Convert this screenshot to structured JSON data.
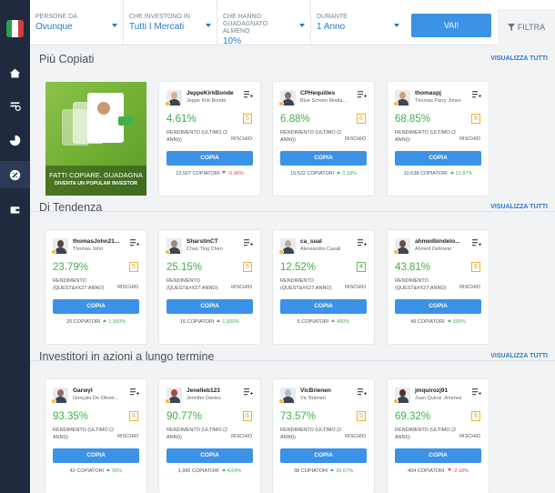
{
  "filters": [
    {
      "label": "PERSONE DA",
      "value": "Ovunque"
    },
    {
      "label": "CHE INVESTONO IN",
      "value": "Tutti I Mercati"
    },
    {
      "label": "CHE HANNO GUADAGNATO ALMENO",
      "value": "10%"
    },
    {
      "label": "DURANTE",
      "value": "1 Anno"
    }
  ],
  "go_button": "VAI!",
  "filter_button": "FILTRA",
  "sections": [
    {
      "title": "Più Copiati",
      "link": "VISUALIZZA TUTTI"
    },
    {
      "title": "Di Tendenza",
      "link": "VISUALIZZA TUTTI"
    },
    {
      "title": "Investitori in azioni a lungo termine",
      "link": "VISUALIZZA TUTTI"
    }
  ],
  "promo": {
    "line1": "FATTI COPIARE. GUADAGNA",
    "line2": "DIVENTA UN POPULAR INVESTOR"
  },
  "labels": {
    "copy": "COPIA",
    "risk": "RISCHIO",
    "copiers": "COPIATORI"
  },
  "cards": [
    {
      "username": "JeppeKirkBonde",
      "fullname": "Jeppe Kirk Bonde",
      "gain": "4.61%",
      "risk": "5",
      "period": "RENDIMENTO (ULTIMO (2 ANNI))",
      "copiers": "23,507",
      "change": "-0.96%",
      "dir": "down",
      "avatar_color": "#d9b38c"
    },
    {
      "username": "CPHequities",
      "fullname": "Blue Screen Media...",
      "gain": "6.88%",
      "risk": "6",
      "period": "RENDIMENTO (ULTIMO (2 ANNI))",
      "copiers": "15,522",
      "change": "0.18%",
      "dir": "up",
      "avatar_color": "#8d6e63"
    },
    {
      "username": "thomaspj",
      "fullname": "Thomas Parry Jones",
      "gain": "68.85%",
      "risk": "6",
      "period": "RENDIMENTO (ULTIMO (2 ANNI))",
      "copiers": "10,638",
      "change": "21.87%",
      "dir": "up",
      "avatar_color": "#c9a27a"
    },
    {
      "username": "thomasJohn21...",
      "fullname": "Thomas John",
      "gain": "23.79%",
      "risk": "5",
      "period": "RENDIMENTO (QUEST&#X27;ANNO)",
      "copiers": "20",
      "change": "1,900%",
      "dir": "up",
      "avatar_color": "#5d4037"
    },
    {
      "username": "SharstinCT",
      "fullname": "Chao Ting Chen",
      "gain": "25.15%",
      "risk": "6",
      "period": "RENDIMENTO (QUEST&#X27;ANNO)",
      "copiers": "16",
      "change": "1,500%",
      "dir": "up",
      "avatar_color": "#a1887f"
    },
    {
      "username": "ca_sual",
      "fullname": "Alessandro Casali",
      "gain": "12.52%",
      "risk": "4",
      "period": "RENDIMENTO (QUEST&#X27;ANNO)",
      "copiers": "5",
      "change": "400%",
      "dir": "up",
      "avatar_color": "#bcaaa4"
    },
    {
      "username": "ahmedbindelo...",
      "fullname": "Ahmed Deliowar",
      "gain": "43.81%",
      "risk": "6",
      "period": "RENDIMENTO (QUEST&#X27;ANNO)",
      "copiers": "49",
      "change": "390%",
      "dir": "up",
      "avatar_color": "#6d4c41"
    },
    {
      "username": "Garwyl",
      "fullname": "Gonçalo De Oliveir...",
      "gain": "93.35%",
      "risk": "6",
      "period": "RENDIMENTO (ULTIMO (2 ANNI))",
      "copiers": "42",
      "change": "50%",
      "dir": "up",
      "avatar_color": "#8d6e63"
    },
    {
      "username": "Jenelleb123",
      "fullname": "Jennifer Davies",
      "gain": "90.77%",
      "risk": "6",
      "period": "RENDIMENTO (ULTIMO (2 ANNI))",
      "copiers": "1,986",
      "change": "4.64%",
      "dir": "up",
      "avatar_color": "#a0522d"
    },
    {
      "username": "VicBrienen",
      "fullname": "Vic Brienen",
      "gain": "73.57%",
      "risk": "5",
      "period": "RENDIMENTO (ULTIMO (2 ANNI))",
      "copiers": "38",
      "change": "26.67%",
      "dir": "up",
      "avatar_color": "#b0bec5"
    },
    {
      "username": "jmquirozj91",
      "fullname": "Juan Quiroz Jimenez",
      "gain": "69.32%",
      "risk": "6",
      "period": "RENDIMENTO (ULTIMO (2 ANNI))",
      "copiers": "404",
      "change": "-2.18%",
      "dir": "down",
      "avatar_color": "#4e342e"
    }
  ]
}
